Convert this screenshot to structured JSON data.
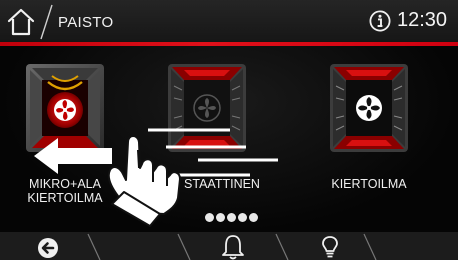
{
  "header": {
    "title": "PAISTO",
    "time": "12:30",
    "home_icon": "home-icon",
    "info_icon": "info-icon",
    "accent_color": "#d00010"
  },
  "modes": [
    {
      "label": "MIKRO+ALA KIERTOILMA",
      "icon": "microwave-bottom-heat-fan-icon",
      "selected": true
    },
    {
      "label": "STAATTINEN",
      "icon": "static-heat-icon",
      "selected": false
    },
    {
      "label": "KIERTOILMA",
      "icon": "fan-heat-icon",
      "selected": false
    }
  ],
  "pager": {
    "count": 5,
    "current": 1
  },
  "bottom_bar": {
    "items": [
      {
        "icon": "back-icon"
      },
      {
        "icon": "bell-timer-icon"
      },
      {
        "icon": "light-bulb-icon"
      }
    ]
  },
  "gesture": {
    "icon": "swipe-left-hand-icon"
  }
}
